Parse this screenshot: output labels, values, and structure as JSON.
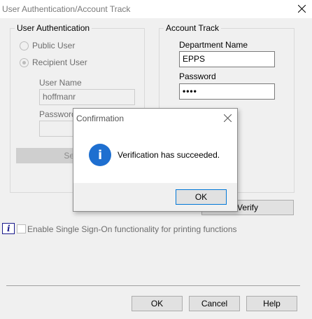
{
  "window": {
    "title": "User Authentication/Account Track"
  },
  "user_auth": {
    "legend": "User Authentication",
    "public_user": "Public User",
    "recipient_user": "Recipient User",
    "user_name_label": "User Name",
    "user_name_value": "hoffmanr",
    "password_label": "Password",
    "server_button": "Server"
  },
  "account_track": {
    "legend": "Account Track",
    "department_label": "Department Name",
    "department_value": "EPPS",
    "password_label": "Password",
    "password_value": "••••",
    "verify_button": "Verify"
  },
  "sso": {
    "label": "Enable Single Sign-On functionality for printing functions"
  },
  "footer": {
    "ok": "OK",
    "cancel": "Cancel",
    "help": "Help"
  },
  "dialog": {
    "title": "Confirmation",
    "message": "Verification has succeeded.",
    "ok": "OK",
    "icon": "info-icon",
    "accent": "#1e6fd0"
  }
}
